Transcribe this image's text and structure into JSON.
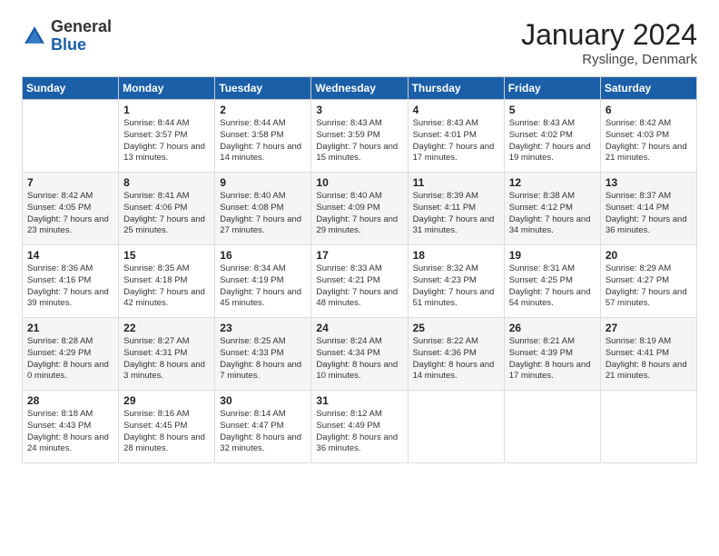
{
  "logo": {
    "general": "General",
    "blue": "Blue"
  },
  "header": {
    "title": "January 2024",
    "location": "Ryslinge, Denmark"
  },
  "days_of_week": [
    "Sunday",
    "Monday",
    "Tuesday",
    "Wednesday",
    "Thursday",
    "Friday",
    "Saturday"
  ],
  "weeks": [
    [
      {
        "num": "",
        "sunrise": "",
        "sunset": "",
        "daylight": ""
      },
      {
        "num": "1",
        "sunrise": "Sunrise: 8:44 AM",
        "sunset": "Sunset: 3:57 PM",
        "daylight": "Daylight: 7 hours and 13 minutes."
      },
      {
        "num": "2",
        "sunrise": "Sunrise: 8:44 AM",
        "sunset": "Sunset: 3:58 PM",
        "daylight": "Daylight: 7 hours and 14 minutes."
      },
      {
        "num": "3",
        "sunrise": "Sunrise: 8:43 AM",
        "sunset": "Sunset: 3:59 PM",
        "daylight": "Daylight: 7 hours and 15 minutes."
      },
      {
        "num": "4",
        "sunrise": "Sunrise: 8:43 AM",
        "sunset": "Sunset: 4:01 PM",
        "daylight": "Daylight: 7 hours and 17 minutes."
      },
      {
        "num": "5",
        "sunrise": "Sunrise: 8:43 AM",
        "sunset": "Sunset: 4:02 PM",
        "daylight": "Daylight: 7 hours and 19 minutes."
      },
      {
        "num": "6",
        "sunrise": "Sunrise: 8:42 AM",
        "sunset": "Sunset: 4:03 PM",
        "daylight": "Daylight: 7 hours and 21 minutes."
      }
    ],
    [
      {
        "num": "7",
        "sunrise": "Sunrise: 8:42 AM",
        "sunset": "Sunset: 4:05 PM",
        "daylight": "Daylight: 7 hours and 23 minutes."
      },
      {
        "num": "8",
        "sunrise": "Sunrise: 8:41 AM",
        "sunset": "Sunset: 4:06 PM",
        "daylight": "Daylight: 7 hours and 25 minutes."
      },
      {
        "num": "9",
        "sunrise": "Sunrise: 8:40 AM",
        "sunset": "Sunset: 4:08 PM",
        "daylight": "Daylight: 7 hours and 27 minutes."
      },
      {
        "num": "10",
        "sunrise": "Sunrise: 8:40 AM",
        "sunset": "Sunset: 4:09 PM",
        "daylight": "Daylight: 7 hours and 29 minutes."
      },
      {
        "num": "11",
        "sunrise": "Sunrise: 8:39 AM",
        "sunset": "Sunset: 4:11 PM",
        "daylight": "Daylight: 7 hours and 31 minutes."
      },
      {
        "num": "12",
        "sunrise": "Sunrise: 8:38 AM",
        "sunset": "Sunset: 4:12 PM",
        "daylight": "Daylight: 7 hours and 34 minutes."
      },
      {
        "num": "13",
        "sunrise": "Sunrise: 8:37 AM",
        "sunset": "Sunset: 4:14 PM",
        "daylight": "Daylight: 7 hours and 36 minutes."
      }
    ],
    [
      {
        "num": "14",
        "sunrise": "Sunrise: 8:36 AM",
        "sunset": "Sunset: 4:16 PM",
        "daylight": "Daylight: 7 hours and 39 minutes."
      },
      {
        "num": "15",
        "sunrise": "Sunrise: 8:35 AM",
        "sunset": "Sunset: 4:18 PM",
        "daylight": "Daylight: 7 hours and 42 minutes."
      },
      {
        "num": "16",
        "sunrise": "Sunrise: 8:34 AM",
        "sunset": "Sunset: 4:19 PM",
        "daylight": "Daylight: 7 hours and 45 minutes."
      },
      {
        "num": "17",
        "sunrise": "Sunrise: 8:33 AM",
        "sunset": "Sunset: 4:21 PM",
        "daylight": "Daylight: 7 hours and 48 minutes."
      },
      {
        "num": "18",
        "sunrise": "Sunrise: 8:32 AM",
        "sunset": "Sunset: 4:23 PM",
        "daylight": "Daylight: 7 hours and 51 minutes."
      },
      {
        "num": "19",
        "sunrise": "Sunrise: 8:31 AM",
        "sunset": "Sunset: 4:25 PM",
        "daylight": "Daylight: 7 hours and 54 minutes."
      },
      {
        "num": "20",
        "sunrise": "Sunrise: 8:29 AM",
        "sunset": "Sunset: 4:27 PM",
        "daylight": "Daylight: 7 hours and 57 minutes."
      }
    ],
    [
      {
        "num": "21",
        "sunrise": "Sunrise: 8:28 AM",
        "sunset": "Sunset: 4:29 PM",
        "daylight": "Daylight: 8 hours and 0 minutes."
      },
      {
        "num": "22",
        "sunrise": "Sunrise: 8:27 AM",
        "sunset": "Sunset: 4:31 PM",
        "daylight": "Daylight: 8 hours and 3 minutes."
      },
      {
        "num": "23",
        "sunrise": "Sunrise: 8:25 AM",
        "sunset": "Sunset: 4:33 PM",
        "daylight": "Daylight: 8 hours and 7 minutes."
      },
      {
        "num": "24",
        "sunrise": "Sunrise: 8:24 AM",
        "sunset": "Sunset: 4:34 PM",
        "daylight": "Daylight: 8 hours and 10 minutes."
      },
      {
        "num": "25",
        "sunrise": "Sunrise: 8:22 AM",
        "sunset": "Sunset: 4:36 PM",
        "daylight": "Daylight: 8 hours and 14 minutes."
      },
      {
        "num": "26",
        "sunrise": "Sunrise: 8:21 AM",
        "sunset": "Sunset: 4:39 PM",
        "daylight": "Daylight: 8 hours and 17 minutes."
      },
      {
        "num": "27",
        "sunrise": "Sunrise: 8:19 AM",
        "sunset": "Sunset: 4:41 PM",
        "daylight": "Daylight: 8 hours and 21 minutes."
      }
    ],
    [
      {
        "num": "28",
        "sunrise": "Sunrise: 8:18 AM",
        "sunset": "Sunset: 4:43 PM",
        "daylight": "Daylight: 8 hours and 24 minutes."
      },
      {
        "num": "29",
        "sunrise": "Sunrise: 8:16 AM",
        "sunset": "Sunset: 4:45 PM",
        "daylight": "Daylight: 8 hours and 28 minutes."
      },
      {
        "num": "30",
        "sunrise": "Sunrise: 8:14 AM",
        "sunset": "Sunset: 4:47 PM",
        "daylight": "Daylight: 8 hours and 32 minutes."
      },
      {
        "num": "31",
        "sunrise": "Sunrise: 8:12 AM",
        "sunset": "Sunset: 4:49 PM",
        "daylight": "Daylight: 8 hours and 36 minutes."
      },
      {
        "num": "",
        "sunrise": "",
        "sunset": "",
        "daylight": ""
      },
      {
        "num": "",
        "sunrise": "",
        "sunset": "",
        "daylight": ""
      },
      {
        "num": "",
        "sunrise": "",
        "sunset": "",
        "daylight": ""
      }
    ]
  ]
}
